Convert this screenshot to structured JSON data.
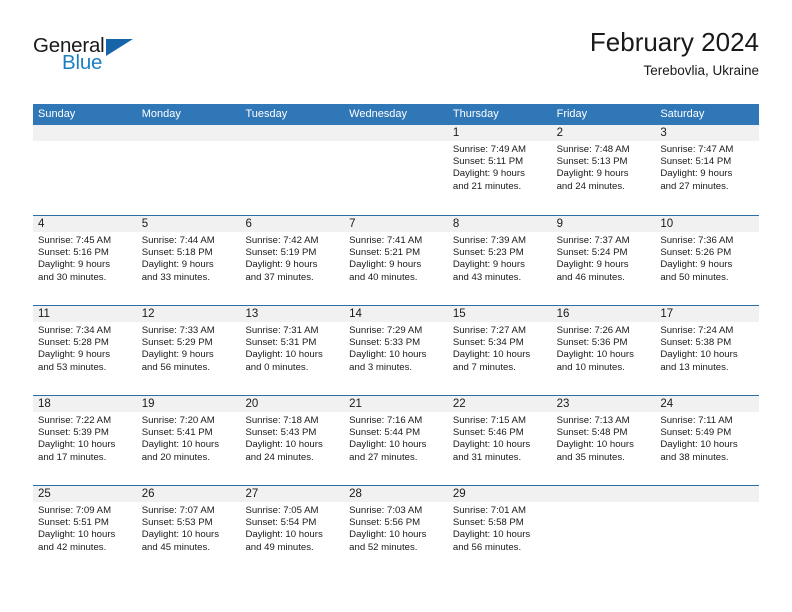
{
  "brand": {
    "name_top": "General",
    "name_bottom": "Blue",
    "triangle_icon": "triangle-icon",
    "color_blue": "#1d7fc3",
    "color_dark": "#1a1a1a"
  },
  "header": {
    "title": "February 2024",
    "subtitle": "Terebovlia, Ukraine"
  },
  "theme": {
    "header_blue": "#3077b8",
    "row_divider_blue": "#2e6da4",
    "daynum_band": "#f1f1f1",
    "text": "#1a1a1a"
  },
  "weekdays": [
    "Sunday",
    "Monday",
    "Tuesday",
    "Wednesday",
    "Thursday",
    "Friday",
    "Saturday"
  ],
  "weeks": [
    [
      {
        "day": "",
        "lines": []
      },
      {
        "day": "",
        "lines": []
      },
      {
        "day": "",
        "lines": []
      },
      {
        "day": "",
        "lines": []
      },
      {
        "day": "1",
        "lines": [
          "Sunrise: 7:49 AM",
          "Sunset: 5:11 PM",
          "Daylight: 9 hours",
          "and 21 minutes."
        ]
      },
      {
        "day": "2",
        "lines": [
          "Sunrise: 7:48 AM",
          "Sunset: 5:13 PM",
          "Daylight: 9 hours",
          "and 24 minutes."
        ]
      },
      {
        "day": "3",
        "lines": [
          "Sunrise: 7:47 AM",
          "Sunset: 5:14 PM",
          "Daylight: 9 hours",
          "and 27 minutes."
        ]
      }
    ],
    [
      {
        "day": "4",
        "lines": [
          "Sunrise: 7:45 AM",
          "Sunset: 5:16 PM",
          "Daylight: 9 hours",
          "and 30 minutes."
        ]
      },
      {
        "day": "5",
        "lines": [
          "Sunrise: 7:44 AM",
          "Sunset: 5:18 PM",
          "Daylight: 9 hours",
          "and 33 minutes."
        ]
      },
      {
        "day": "6",
        "lines": [
          "Sunrise: 7:42 AM",
          "Sunset: 5:19 PM",
          "Daylight: 9 hours",
          "and 37 minutes."
        ]
      },
      {
        "day": "7",
        "lines": [
          "Sunrise: 7:41 AM",
          "Sunset: 5:21 PM",
          "Daylight: 9 hours",
          "and 40 minutes."
        ]
      },
      {
        "day": "8",
        "lines": [
          "Sunrise: 7:39 AM",
          "Sunset: 5:23 PM",
          "Daylight: 9 hours",
          "and 43 minutes."
        ]
      },
      {
        "day": "9",
        "lines": [
          "Sunrise: 7:37 AM",
          "Sunset: 5:24 PM",
          "Daylight: 9 hours",
          "and 46 minutes."
        ]
      },
      {
        "day": "10",
        "lines": [
          "Sunrise: 7:36 AM",
          "Sunset: 5:26 PM",
          "Daylight: 9 hours",
          "and 50 minutes."
        ]
      }
    ],
    [
      {
        "day": "11",
        "lines": [
          "Sunrise: 7:34 AM",
          "Sunset: 5:28 PM",
          "Daylight: 9 hours",
          "and 53 minutes."
        ]
      },
      {
        "day": "12",
        "lines": [
          "Sunrise: 7:33 AM",
          "Sunset: 5:29 PM",
          "Daylight: 9 hours",
          "and 56 minutes."
        ]
      },
      {
        "day": "13",
        "lines": [
          "Sunrise: 7:31 AM",
          "Sunset: 5:31 PM",
          "Daylight: 10 hours",
          "and 0 minutes."
        ]
      },
      {
        "day": "14",
        "lines": [
          "Sunrise: 7:29 AM",
          "Sunset: 5:33 PM",
          "Daylight: 10 hours",
          "and 3 minutes."
        ]
      },
      {
        "day": "15",
        "lines": [
          "Sunrise: 7:27 AM",
          "Sunset: 5:34 PM",
          "Daylight: 10 hours",
          "and 7 minutes."
        ]
      },
      {
        "day": "16",
        "lines": [
          "Sunrise: 7:26 AM",
          "Sunset: 5:36 PM",
          "Daylight: 10 hours",
          "and 10 minutes."
        ]
      },
      {
        "day": "17",
        "lines": [
          "Sunrise: 7:24 AM",
          "Sunset: 5:38 PM",
          "Daylight: 10 hours",
          "and 13 minutes."
        ]
      }
    ],
    [
      {
        "day": "18",
        "lines": [
          "Sunrise: 7:22 AM",
          "Sunset: 5:39 PM",
          "Daylight: 10 hours",
          "and 17 minutes."
        ]
      },
      {
        "day": "19",
        "lines": [
          "Sunrise: 7:20 AM",
          "Sunset: 5:41 PM",
          "Daylight: 10 hours",
          "and 20 minutes."
        ]
      },
      {
        "day": "20",
        "lines": [
          "Sunrise: 7:18 AM",
          "Sunset: 5:43 PM",
          "Daylight: 10 hours",
          "and 24 minutes."
        ]
      },
      {
        "day": "21",
        "lines": [
          "Sunrise: 7:16 AM",
          "Sunset: 5:44 PM",
          "Daylight: 10 hours",
          "and 27 minutes."
        ]
      },
      {
        "day": "22",
        "lines": [
          "Sunrise: 7:15 AM",
          "Sunset: 5:46 PM",
          "Daylight: 10 hours",
          "and 31 minutes."
        ]
      },
      {
        "day": "23",
        "lines": [
          "Sunrise: 7:13 AM",
          "Sunset: 5:48 PM",
          "Daylight: 10 hours",
          "and 35 minutes."
        ]
      },
      {
        "day": "24",
        "lines": [
          "Sunrise: 7:11 AM",
          "Sunset: 5:49 PM",
          "Daylight: 10 hours",
          "and 38 minutes."
        ]
      }
    ],
    [
      {
        "day": "25",
        "lines": [
          "Sunrise: 7:09 AM",
          "Sunset: 5:51 PM",
          "Daylight: 10 hours",
          "and 42 minutes."
        ]
      },
      {
        "day": "26",
        "lines": [
          "Sunrise: 7:07 AM",
          "Sunset: 5:53 PM",
          "Daylight: 10 hours",
          "and 45 minutes."
        ]
      },
      {
        "day": "27",
        "lines": [
          "Sunrise: 7:05 AM",
          "Sunset: 5:54 PM",
          "Daylight: 10 hours",
          "and 49 minutes."
        ]
      },
      {
        "day": "28",
        "lines": [
          "Sunrise: 7:03 AM",
          "Sunset: 5:56 PM",
          "Daylight: 10 hours",
          "and 52 minutes."
        ]
      },
      {
        "day": "29",
        "lines": [
          "Sunrise: 7:01 AM",
          "Sunset: 5:58 PM",
          "Daylight: 10 hours",
          "and 56 minutes."
        ]
      },
      {
        "day": "",
        "lines": []
      },
      {
        "day": "",
        "lines": []
      }
    ]
  ]
}
